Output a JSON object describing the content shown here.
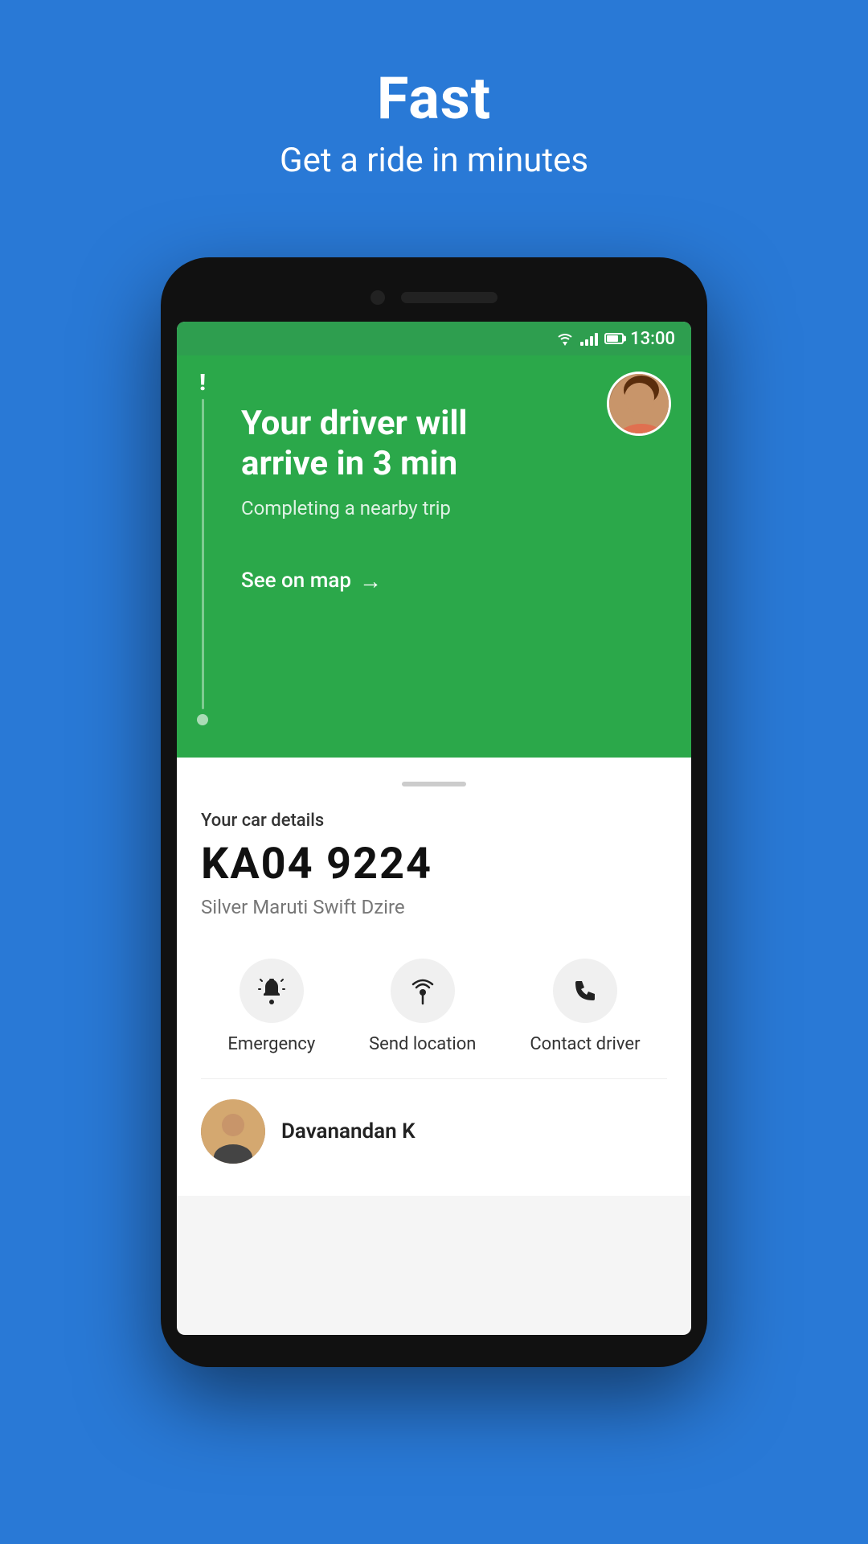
{
  "header": {
    "title": "Fast",
    "subtitle": "Get a ride in minutes"
  },
  "status_bar": {
    "time": "13:00"
  },
  "green_card": {
    "arrival_text": "Your driver will arrive in 3 min",
    "arrival_line1": "Your driver will",
    "arrival_line2": "arrive in 3 min",
    "subtitle": "Completing a nearby trip",
    "see_on_map": "See on map"
  },
  "car_details": {
    "section_label": "Your car details",
    "plate": "KA04 9224",
    "model": "Silver Maruti Swift Dzire"
  },
  "actions": {
    "emergency": {
      "label": "Emergency",
      "icon": "🔔"
    },
    "send_location": {
      "label": "Send location",
      "icon": "📡"
    },
    "contact_driver": {
      "label": "Contact driver",
      "icon": "📞"
    }
  },
  "driver": {
    "name": "Davanandan K"
  }
}
